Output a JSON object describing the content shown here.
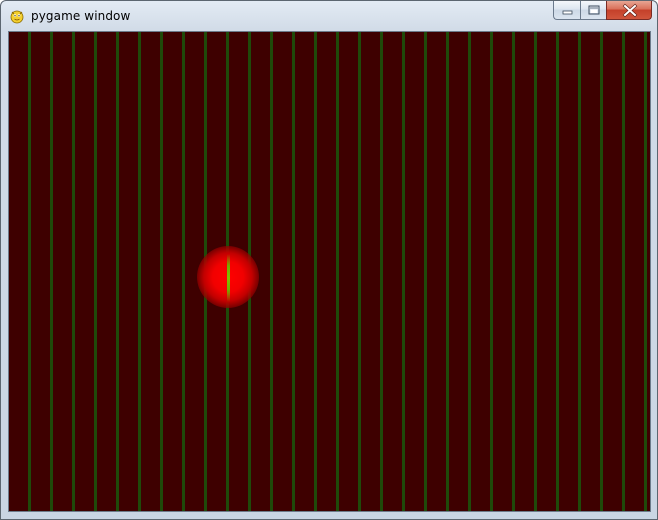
{
  "window": {
    "title": "pygame window",
    "app_icon": "pygame-snake-icon",
    "controls": {
      "minimize_icon": "minimize-icon",
      "maximize_icon": "maximize-icon",
      "close_icon": "close-icon"
    }
  },
  "canvas": {
    "background_color": "#3e0000",
    "stripe_color": "#1f4a0a",
    "glow_color": "#ff0000",
    "glow_line_color": "#80c000"
  }
}
